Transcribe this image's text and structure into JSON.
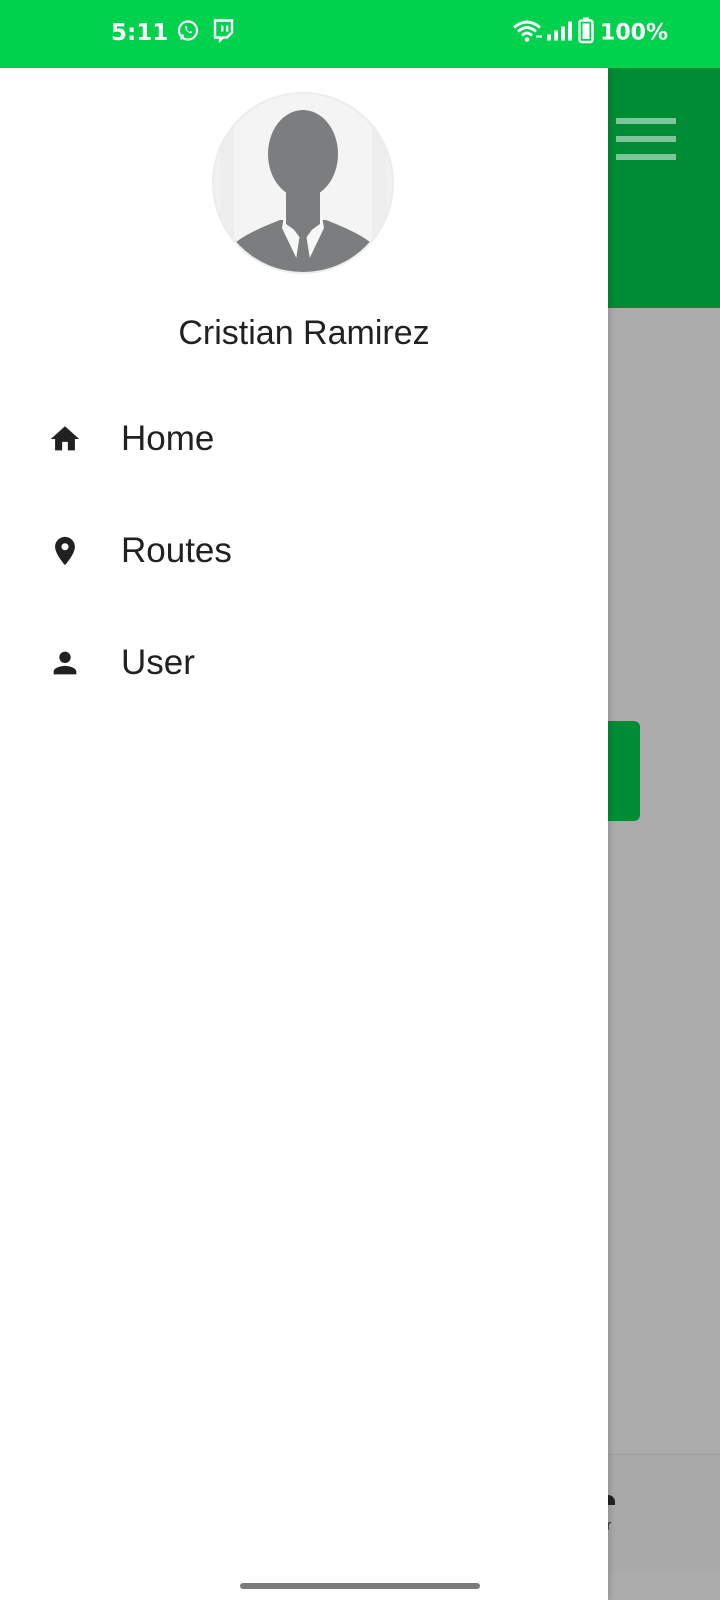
{
  "status_bar": {
    "time": "5:11",
    "battery_percent": "100%",
    "app_icons": [
      "whatsapp-icon",
      "twitch-icon"
    ],
    "system_icons": [
      "wifi-icon",
      "signal-icon",
      "battery-icon"
    ],
    "color": "#00d24e"
  },
  "drawer": {
    "user_name": "Cristian Ramirez",
    "avatar": "default-person-avatar",
    "menu": [
      {
        "label": "Home",
        "icon": "home-icon"
      },
      {
        "label": "Routes",
        "icon": "location-pin-icon"
      },
      {
        "label": "User",
        "icon": "person-icon"
      }
    ]
  },
  "background_app": {
    "toolbar_color": "#008c35",
    "menu_icon": "hamburger-menu-icon",
    "bottom_nav_partial_label": "er"
  }
}
